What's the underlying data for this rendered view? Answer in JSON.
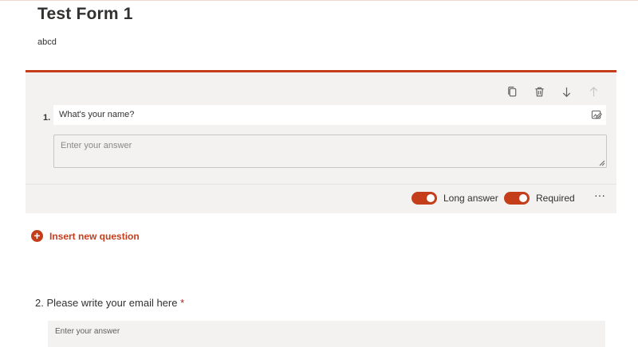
{
  "form": {
    "title": "Test Form 1",
    "description": "abcd"
  },
  "question1": {
    "number": "1.",
    "title": "What's your name?",
    "placeholder": "Enter your answer",
    "toolbar": {
      "copy_icon": "copy-icon",
      "delete_icon": "trash-icon",
      "move_down_icon": "arrow-down-icon",
      "move_up_icon": "arrow-up-icon"
    },
    "long_answer": {
      "label": "Long answer",
      "enabled": true
    },
    "required": {
      "label": "Required",
      "enabled": true
    },
    "more": "···"
  },
  "insert": {
    "plus": "+",
    "label": "Insert new question"
  },
  "question2": {
    "title": "2. Please write your email here",
    "required_marker": "*",
    "placeholder": "Enter your answer"
  },
  "colors": {
    "accent": "#c43e1c",
    "card_bg": "#f3f2f1",
    "required_red": "#a4262c"
  }
}
